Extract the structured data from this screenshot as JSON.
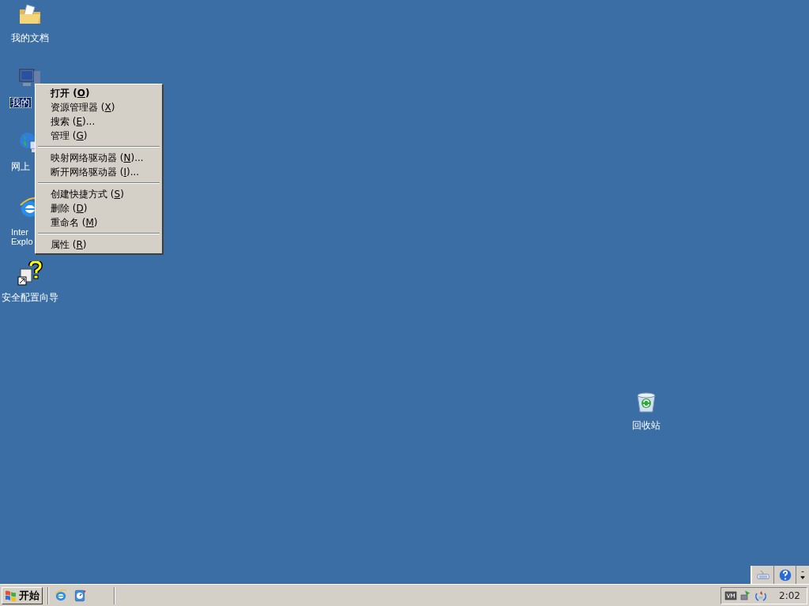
{
  "desktop_icons": [
    {
      "kind": "documents",
      "label": "我的文档",
      "selected": false
    },
    {
      "kind": "computer",
      "label": "我的",
      "selected": true
    },
    {
      "kind": "network",
      "label": "网上",
      "selected": false
    },
    {
      "kind": "ie",
      "label": "Inter Explo",
      "selected": false
    },
    {
      "kind": "wizard",
      "label": "安全配置向导",
      "selected": false
    },
    {
      "kind": "recycle",
      "label": "回收站",
      "selected": false
    }
  ],
  "context_menu": {
    "items": [
      {
        "kind": "item",
        "text": "打开 (O)",
        "default": true
      },
      {
        "kind": "item",
        "text": "资源管理器 (X)",
        "default": false
      },
      {
        "kind": "item",
        "text": "搜索 (E)...",
        "default": false
      },
      {
        "kind": "item",
        "text": "管理 (G)",
        "default": false
      },
      {
        "kind": "separator"
      },
      {
        "kind": "item",
        "text": "映射网络驱动器 (N)...",
        "default": false
      },
      {
        "kind": "item",
        "text": "断开网络驱动器 (I)...",
        "default": false
      },
      {
        "kind": "separator"
      },
      {
        "kind": "item",
        "text": "创建快捷方式 (S)",
        "default": false
      },
      {
        "kind": "item",
        "text": "删除 (D)",
        "default": false
      },
      {
        "kind": "item",
        "text": "重命名 (M)",
        "default": false
      },
      {
        "kind": "separator"
      },
      {
        "kind": "item",
        "text": "属性 (R)",
        "default": false
      }
    ]
  },
  "language_bar": {
    "buttons": [
      {
        "kind": "keyboard"
      },
      {
        "kind": "help"
      },
      {
        "kind": "options"
      }
    ]
  },
  "taskbar": {
    "start_button": "开始",
    "quick_launch": [
      {
        "kind": "ie"
      },
      {
        "kind": "desktop"
      }
    ],
    "tray_icons": [
      {
        "kind": "vm"
      },
      {
        "kind": "network"
      },
      {
        "kind": "sync"
      }
    ],
    "clock": "2:02"
  }
}
